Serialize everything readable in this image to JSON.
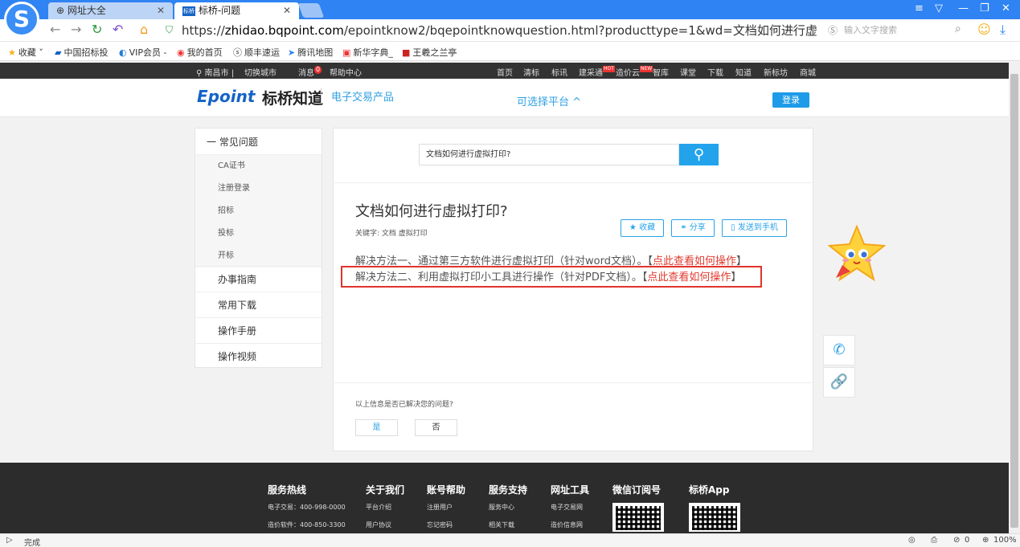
{
  "browser": {
    "tabs": [
      {
        "label": "网址大全"
      },
      {
        "label": "标桥-问题",
        "favicon": "标桥"
      }
    ],
    "url_prefix": "https://",
    "url_domain": "zhidao.bqpoint.com",
    "url_path": "/epointknow2/bqepointknowquestion.html?producttype=1&wd=文档如何进行虚拟打印？&Question(",
    "search_placeholder": "输入文字搜索",
    "bookmarks": [
      {
        "label": "收藏",
        "icon": "star-icon"
      },
      {
        "label": "中国招标投",
        "icon": "site-icon"
      },
      {
        "label": "VIP会员 -",
        "icon": "vip-icon"
      },
      {
        "label": "我的首页",
        "icon": "weibo-icon"
      },
      {
        "label": "顺丰速运",
        "icon": "sf-icon"
      },
      {
        "label": "腾讯地图",
        "icon": "map-icon"
      },
      {
        "label": "新华字典_",
        "icon": "dict-icon"
      },
      {
        "label": "王羲之兰亭",
        "icon": "book-icon"
      }
    ],
    "status": "完成",
    "zoom": "100%",
    "count": "0"
  },
  "topnav": {
    "city": "南昌市",
    "switch_city": "切换城市",
    "msg": "消息",
    "msg_count": "0",
    "help": "帮助中心",
    "links": [
      "首页",
      "清标",
      "标讯",
      "建采通",
      "造价云",
      "智库",
      "课堂",
      "下载",
      "知道",
      "新标坊",
      "商城"
    ],
    "hot_tag": "HOT",
    "new_tag": "NEW"
  },
  "header": {
    "brand": "Epoint",
    "brand_cn": "标桥知道",
    "sub": "电子交易产品",
    "platform": "可选择平台 ^",
    "login": "登录"
  },
  "sidebar": {
    "section": "一 常见问题",
    "sub_items": [
      "CA证书",
      "注册登录",
      "招标",
      "投标",
      "开标"
    ],
    "menus": [
      "办事指南",
      "常用下载",
      "操作手册",
      "操作视频"
    ]
  },
  "main": {
    "search_value": "文档如何进行虚拟打印?",
    "title": "文档如何进行虚拟打印?",
    "keywords_label": "关键字:",
    "keywords": "文档  虚拟打印",
    "btn_collect": "收藏",
    "btn_share": "分享",
    "btn_send": "发送到手机",
    "answer1_text": "解决方法一、通过第三方软件进行虚拟打印（针对word文档）。【",
    "answer1_link": "点此查看如何操作",
    "answer2_text": "解决方法二、利用虚拟打印小工具进行操作（针对PDF文档）。【",
    "answer2_link": "点此查看如何操作",
    "close_bracket": "】",
    "feedback_q": "以上信息是否已解决您的问题?",
    "yes": "是",
    "no": "否"
  },
  "footer": {
    "cols": [
      {
        "h": "服务热线",
        "items": [
          "电子交易：400-998-0000",
          "造价软件：400-850-3300"
        ]
      },
      {
        "h": "关于我们",
        "items": [
          "平台介绍",
          "用户协议"
        ]
      },
      {
        "h": "账号帮助",
        "items": [
          "注册用户",
          "忘记密码"
        ]
      },
      {
        "h": "服务支持",
        "items": [
          "服务中心",
          "相关下载"
        ]
      },
      {
        "h": "网址工具",
        "items": [
          "电子交易网",
          "造价信息网"
        ]
      }
    ],
    "wechat": "微信订阅号",
    "app": "标桥App"
  }
}
